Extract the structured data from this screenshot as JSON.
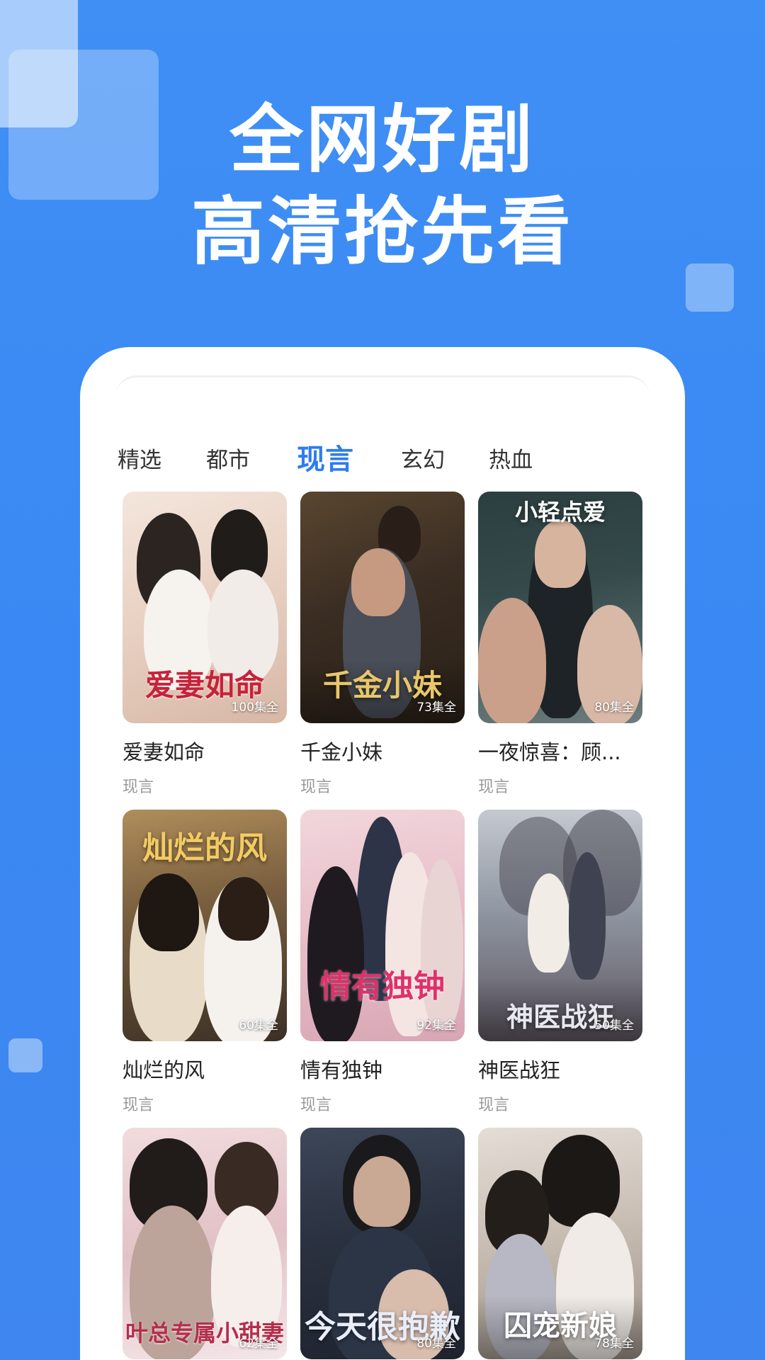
{
  "headline": {
    "line1": "全网好剧",
    "line2": "高清抢先看"
  },
  "tabs": [
    {
      "label": "精选",
      "active": false
    },
    {
      "label": "都市",
      "active": false
    },
    {
      "label": "现言",
      "active": true
    },
    {
      "label": "玄幻",
      "active": false
    },
    {
      "label": "热血",
      "active": false
    }
  ],
  "dramas": [
    {
      "title": "爱妻如命",
      "poster_text": "爱妻如命",
      "episodes": "100集全",
      "genre": "现言"
    },
    {
      "title": "千金小妹",
      "poster_text": "千金小妹",
      "episodes": "73集全",
      "genre": "现言"
    },
    {
      "title": "一夜惊喜：顾...",
      "poster_text": "小轻点爱",
      "episodes": "80集全",
      "genre": "现言"
    },
    {
      "title": "灿烂的风",
      "poster_text": "灿烂的风",
      "episodes": "60集全",
      "genre": "现言"
    },
    {
      "title": "情有独钟",
      "poster_text": "情有独钟",
      "episodes": "92集全",
      "genre": "现言"
    },
    {
      "title": "神医战狂",
      "poster_text": "神医战狂",
      "episodes": "50集全",
      "genre": "现言"
    },
    {
      "title": "",
      "poster_text": "叶总专属小甜妻",
      "episodes": "62集全",
      "genre": ""
    },
    {
      "title": "",
      "poster_text": "今天很抱歉",
      "episodes": "80集全",
      "genre": ""
    },
    {
      "title": "",
      "poster_text": "囚宠新娘",
      "episodes": "78集全",
      "genre": ""
    }
  ],
  "colors": {
    "background": "#3f8ff5",
    "tab_active": "#2f7cf0",
    "tab_inactive": "#333333",
    "genre_text": "#999999"
  }
}
